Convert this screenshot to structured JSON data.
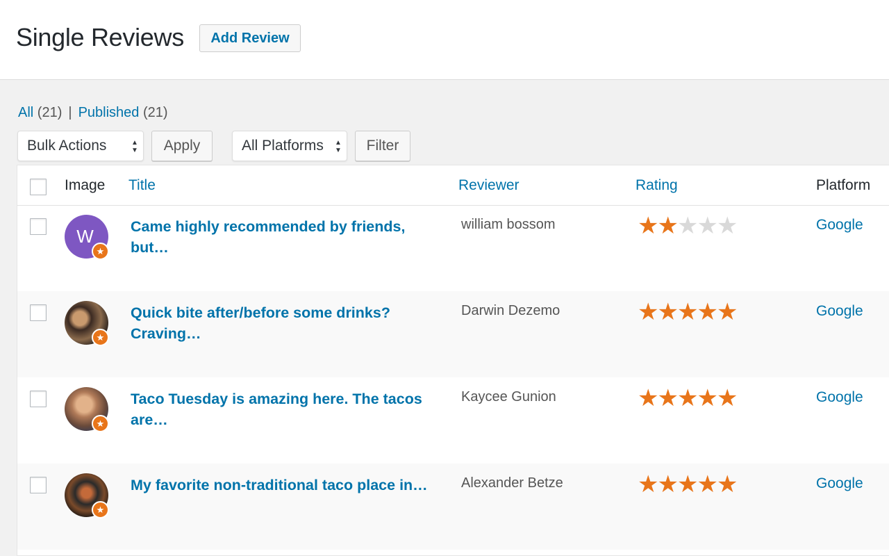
{
  "header": {
    "title": "Single Reviews",
    "add_label": "Add Review"
  },
  "views": {
    "all": {
      "label": "All",
      "count": "(21)"
    },
    "separator": "|",
    "published": {
      "label": "Published",
      "count": "(21)"
    }
  },
  "toolbar": {
    "bulk_select": "Bulk Actions",
    "apply_label": "Apply",
    "platform_select": "All Platforms",
    "filter_label": "Filter"
  },
  "columns": {
    "image": "Image",
    "title": "Title",
    "reviewer": "Reviewer",
    "rating": "Rating",
    "platform": "Platform"
  },
  "colors": {
    "accent": "#0073aa",
    "star": "#e8751a",
    "star_empty": "#d9d9d9",
    "avatar_w": "#7e57c2"
  },
  "rows": [
    {
      "title": "Came highly recommended by friends, but…",
      "reviewer": "william bossom",
      "rating": 2,
      "platform": "Google",
      "avatar": {
        "letter": "W",
        "color": "#7e57c2"
      }
    },
    {
      "title": "Quick bite after/before some drinks? Craving…",
      "reviewer": "Darwin Dezemo",
      "rating": 5,
      "platform": "Google",
      "avatar": {
        "letter": "",
        "photo": "photo-avatar"
      }
    },
    {
      "title": "Taco Tuesday is amazing here. The tacos are…",
      "reviewer": "Kaycee Gunion",
      "rating": 5,
      "platform": "Google",
      "avatar": {
        "letter": "",
        "photo": "photo-avatar"
      }
    },
    {
      "title": "My favorite non-traditional taco place in…",
      "reviewer": "Alexander Betze",
      "rating": 5,
      "platform": "Google",
      "avatar": {
        "letter": "",
        "photo": "photo-avatar"
      }
    }
  ]
}
